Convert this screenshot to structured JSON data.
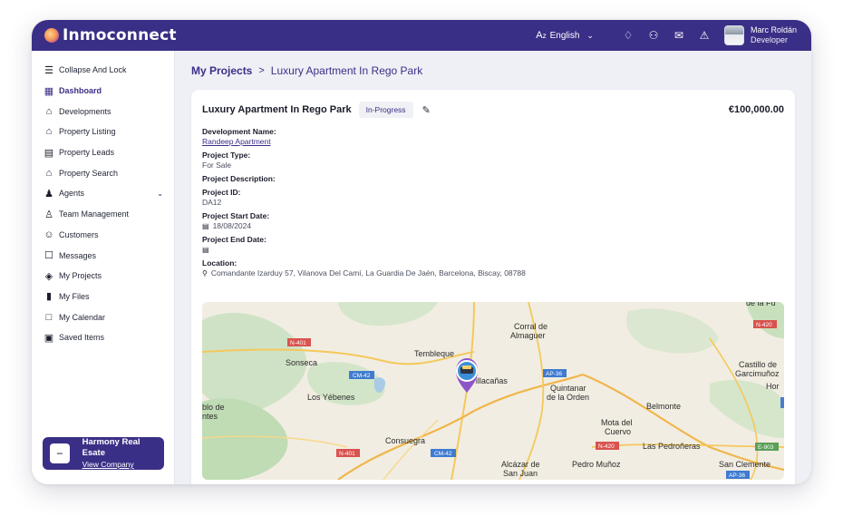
{
  "app": {
    "brand": "Inmoconnect"
  },
  "topbar": {
    "language": "English",
    "user_name": "Marc Roldán",
    "user_role": "Developer",
    "icons": [
      "translate-icon",
      "bell-icon",
      "user-share-icon",
      "mail-icon",
      "alert-bell-icon"
    ]
  },
  "sidebar": {
    "items": [
      {
        "label": "Collapse And Lock",
        "icon": "menu-collapse-icon",
        "active": false
      },
      {
        "label": "Dashboard",
        "icon": "dashboard-icon",
        "active": true
      },
      {
        "label": "Developments",
        "icon": "developments-icon",
        "active": false
      },
      {
        "label": "Property Listing",
        "icon": "property-listing-icon",
        "active": false
      },
      {
        "label": "Property Leads",
        "icon": "property-leads-icon",
        "active": false
      },
      {
        "label": "Property Search",
        "icon": "property-search-icon",
        "active": false
      },
      {
        "label": "Agents",
        "icon": "agents-icon",
        "active": false
      },
      {
        "label": "Team Management",
        "icon": "team-icon",
        "active": false
      },
      {
        "label": "Customers",
        "icon": "customers-icon",
        "active": false
      },
      {
        "label": "Messages",
        "icon": "messages-icon",
        "active": false
      },
      {
        "label": "My Projects",
        "icon": "projects-icon",
        "active": false
      },
      {
        "label": "My Files",
        "icon": "files-icon",
        "active": false
      },
      {
        "label": "My Calendar",
        "icon": "calendar-icon",
        "active": false
      },
      {
        "label": "Saved Items",
        "icon": "saved-icon",
        "active": false
      }
    ],
    "company": {
      "name": "Harmony Real Esate",
      "link": "View Company"
    }
  },
  "breadcrumb": {
    "root": "My Projects",
    "separator": ">",
    "current": "Luxury Apartment In Rego Park"
  },
  "project": {
    "title": "Luxury Apartment In Rego Park",
    "status": "In-Progress",
    "price": "€100,000.00",
    "fields": {
      "development_label": "Development Name:",
      "development_value": "Randeep Apartment",
      "type_label": "Project Type:",
      "type_value": "For Sale",
      "description_label": "Project Description:",
      "id_label": "Project ID:",
      "id_value": "DA12",
      "start_label": "Project Start Date:",
      "start_value": "18/08/2024",
      "end_label": "Project End Date:",
      "location_label": "Location:",
      "location_value": "Comandante Izarduy 57, Vilanova Del Camí, La Guardia De Jaén, Barcelona, Biscay, 08788"
    }
  },
  "map": {
    "places": [
      "Corral de",
      "Almaguer",
      "Tembleque",
      "Sonseca",
      "Los Yébenes",
      "blo de",
      "ntes",
      "Villacañas",
      "Quintanar",
      "de la Orden",
      "Belmonte",
      "Mota del",
      "Cuervo",
      "Castillo de",
      "Garcimuñoz",
      "Hor",
      "Consuegra",
      "Alcázar de",
      "San Juan",
      "Pedro Muñoz",
      "Las Pedroñeras",
      "San Clemente",
      "de la Fu"
    ],
    "roads": [
      "N-401",
      "CM-42",
      "AP-36",
      "N-420",
      "E-903",
      "N-401",
      "CM-42",
      "N-420",
      "AP-36"
    ]
  }
}
